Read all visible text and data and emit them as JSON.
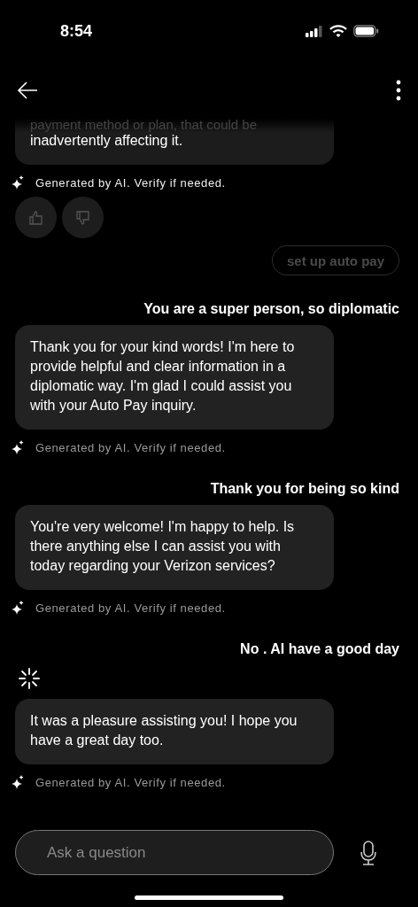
{
  "status_bar": {
    "time": "8:54"
  },
  "messages": [
    {
      "kind": "bot",
      "faded_text": "payment method or plan, that could be",
      "text": "inadvertently affecting it.",
      "disclaimer": "Generated by AI. Verify if needed.",
      "disclaimer_bright": true,
      "feedback": true
    },
    {
      "kind": "chip",
      "text": "set up auto pay"
    },
    {
      "kind": "user",
      "text": "You are a super person, so diplomatic"
    },
    {
      "kind": "bot",
      "text": "Thank you for your kind words! I'm here to provide helpful and clear information in a diplomatic way. I'm glad I could assist you with your Auto Pay inquiry.",
      "disclaimer": "Generated by AI. Verify if needed.",
      "disclaimer_bright": false
    },
    {
      "kind": "user",
      "text": "Thank you for being so kind"
    },
    {
      "kind": "bot",
      "text": "You're very welcome! I'm happy to help. Is there anything else I can assist you with today regarding your Verizon services?",
      "disclaimer": "Generated by AI. Verify if needed.",
      "disclaimer_bright": false
    },
    {
      "kind": "user",
      "text": "No . AI have a good day"
    },
    {
      "kind": "bot",
      "text": "It was a pleasure assisting you! I hope you have a great day too.",
      "disclaimer": "Generated by AI. Verify if needed.",
      "disclaimer_bright": false,
      "thinking_icon": true
    }
  ],
  "input": {
    "placeholder": "Ask a question"
  }
}
